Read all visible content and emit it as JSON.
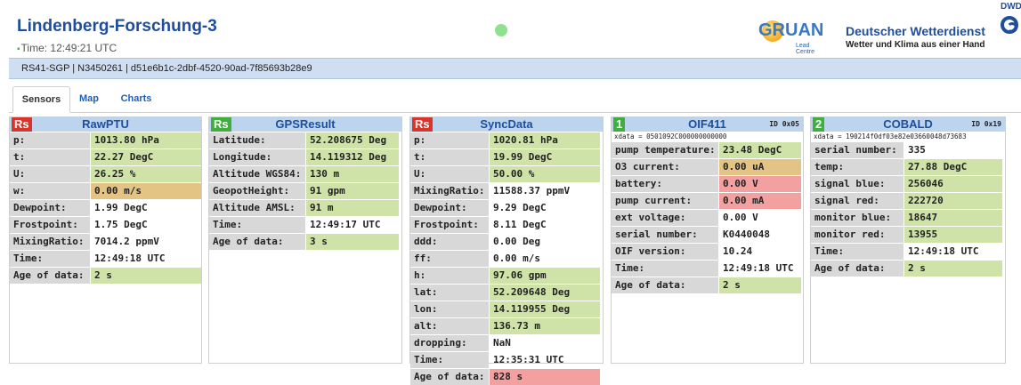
{
  "header": {
    "station": "Lindenberg-Forschung-3",
    "time": "Time: 12:49:21 UTC",
    "gruan_logo_text": "GRUAN",
    "gruan_sub": "Lead Centre",
    "dwd_name": "Deutscher Wetterdienst",
    "dwd_slogan": "Wetter und Klima aus einer Hand",
    "dwd_badge": "DWD"
  },
  "id_bar": "RS41-SGP | N3450261 | d51e6b1c-2dbf-4520-90ad-7f85693b28e9",
  "tabs": [
    "Sensors",
    "Map",
    "Charts"
  ],
  "colors": {
    "header_blue": "#1f4e9c",
    "panel_header": "#bcd4ee",
    "ok": "#cfe3a8",
    "warn": "#e4c485",
    "bad": "#f2a0a0",
    "badge_green": "#3fae3f",
    "badge_red": "#d9342b"
  },
  "panels": {
    "rawptu": {
      "badge": "Rs",
      "title": "RawPTU",
      "rows": [
        {
          "label": "p:",
          "value": "1013.80 hPa",
          "status": "green"
        },
        {
          "label": "t:",
          "value": "22.27 DegC",
          "status": "green"
        },
        {
          "label": "U:",
          "value": "26.25 %",
          "status": "green"
        },
        {
          "label": "w:",
          "value": "0.00 m/s",
          "status": "orange"
        },
        {
          "label": "Dewpoint:",
          "value": "1.99 DegC",
          "status": "none"
        },
        {
          "label": "Frostpoint:",
          "value": "1.75 DegC",
          "status": "none"
        },
        {
          "label": "MixingRatio:",
          "value": "7014.2 ppmV",
          "status": "none"
        },
        {
          "label": "Time:",
          "value": "12:49:18 UTC",
          "status": "none"
        },
        {
          "label": "Age of data:",
          "value": "2 s",
          "status": "green"
        }
      ]
    },
    "gpsresult": {
      "badge": "Rs",
      "title": "GPSResult",
      "rows": [
        {
          "label": "Latitude:",
          "value": "52.208675 Deg",
          "status": "green"
        },
        {
          "label": "Longitude:",
          "value": "14.119312 Deg",
          "status": "green"
        },
        {
          "label": "Altitude WGS84:",
          "value": "130 m",
          "status": "green"
        },
        {
          "label": "GeopotHeight:",
          "value": "91 gpm",
          "status": "green"
        },
        {
          "label": "Altitude AMSL:",
          "value": "91 m",
          "status": "green"
        },
        {
          "label": "Time:",
          "value": "12:49:17 UTC",
          "status": "none"
        },
        {
          "label": "Age of data:",
          "value": "3 s",
          "status": "green"
        }
      ]
    },
    "syncdata": {
      "badge": "Rs",
      "title": "SyncData",
      "rows": [
        {
          "label": "p:",
          "value": "1020.81 hPa",
          "status": "green"
        },
        {
          "label": "t:",
          "value": "19.99 DegC",
          "status": "green"
        },
        {
          "label": "U:",
          "value": "50.00 %",
          "status": "green"
        },
        {
          "label": "MixingRatio:",
          "value": "11588.37 ppmV",
          "status": "none"
        },
        {
          "label": "Dewpoint:",
          "value": "9.29 DegC",
          "status": "none"
        },
        {
          "label": "Frostpoint:",
          "value": "8.11 DegC",
          "status": "none"
        },
        {
          "label": "ddd:",
          "value": "0.00 Deg",
          "status": "none"
        },
        {
          "label": "ff:",
          "value": "0.00 m/s",
          "status": "none"
        },
        {
          "label": "h:",
          "value": "97.06 gpm",
          "status": "green"
        },
        {
          "label": "lat:",
          "value": "52.209648 Deg",
          "status": "green"
        },
        {
          "label": "lon:",
          "value": "14.119955 Deg",
          "status": "green"
        },
        {
          "label": "alt:",
          "value": "136.73 m",
          "status": "green"
        },
        {
          "label": "dropping:",
          "value": "NaN",
          "status": "none"
        },
        {
          "label": "Time:",
          "value": "12:35:31 UTC",
          "status": "none"
        },
        {
          "label": "Age of data:",
          "value": "828 s",
          "status": "red"
        }
      ]
    },
    "oif411": {
      "badge": "1",
      "title": "OIF411",
      "id": "ID 0x05",
      "xdata": "xdata = 0501092C000000000000",
      "rows": [
        {
          "label": "pump temperature:",
          "value": "23.48 DegC",
          "status": "green"
        },
        {
          "label": "O3 current:",
          "value": "0.00 uA",
          "status": "orange"
        },
        {
          "label": "battery:",
          "value": "0.00 V",
          "status": "red"
        },
        {
          "label": "pump current:",
          "value": "0.00 mA",
          "status": "red"
        },
        {
          "label": "ext voltage:",
          "value": "0.00 V",
          "status": "none"
        },
        {
          "label": "serial number:",
          "value": "K0440048",
          "status": "none"
        },
        {
          "label": "OIF version:",
          "value": "10.24",
          "status": "none"
        },
        {
          "label": "Time:",
          "value": "12:49:18 UTC",
          "status": "none"
        },
        {
          "label": "Age of data:",
          "value": "2 s",
          "status": "green"
        }
      ]
    },
    "cobald": {
      "badge": "2",
      "title": "COBALD",
      "id": "ID 0x19",
      "xdata": "xdata = 190214f0df03e82e03660048d73683",
      "rows": [
        {
          "label": "serial number:",
          "value": "335",
          "status": "none"
        },
        {
          "label": "temp:",
          "value": "27.88 DegC",
          "status": "green"
        },
        {
          "label": "signal blue:",
          "value": "256046",
          "status": "green"
        },
        {
          "label": "signal red:",
          "value": "222720",
          "status": "green"
        },
        {
          "label": "monitor blue:",
          "value": "18647",
          "status": "green"
        },
        {
          "label": "monitor red:",
          "value": "13955",
          "status": "green"
        },
        {
          "label": "Time:",
          "value": "12:49:18 UTC",
          "status": "none"
        },
        {
          "label": "Age of data:",
          "value": "2 s",
          "status": "green"
        }
      ]
    }
  }
}
